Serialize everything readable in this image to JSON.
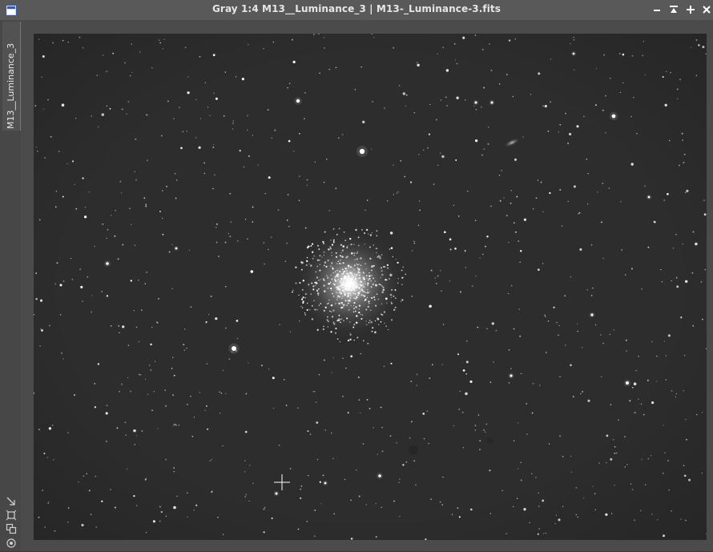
{
  "window": {
    "title": "Gray 1:4 M13__Luminance_3 | M13-_Luminance-3.fits",
    "app_icon": "window-icon",
    "controls": [
      {
        "name": "minimize-icon"
      },
      {
        "name": "shade-icon"
      },
      {
        "name": "maximize-icon"
      },
      {
        "name": "close-icon"
      }
    ]
  },
  "side_panel": {
    "view_tab_label": "M13__Luminance_3",
    "tools": [
      "fit-view-icon",
      "zoom-fit-icon",
      "clone-view-icon",
      "settings-icon"
    ]
  },
  "image": {
    "object": "globular-cluster",
    "cursor": "crosshair-cursor-icon"
  },
  "colors": {
    "title_bar": "#595959",
    "canvas_bg": "#2c2c2c",
    "frame": "#4b4b4b",
    "tab_accent": "#2fa05a"
  }
}
